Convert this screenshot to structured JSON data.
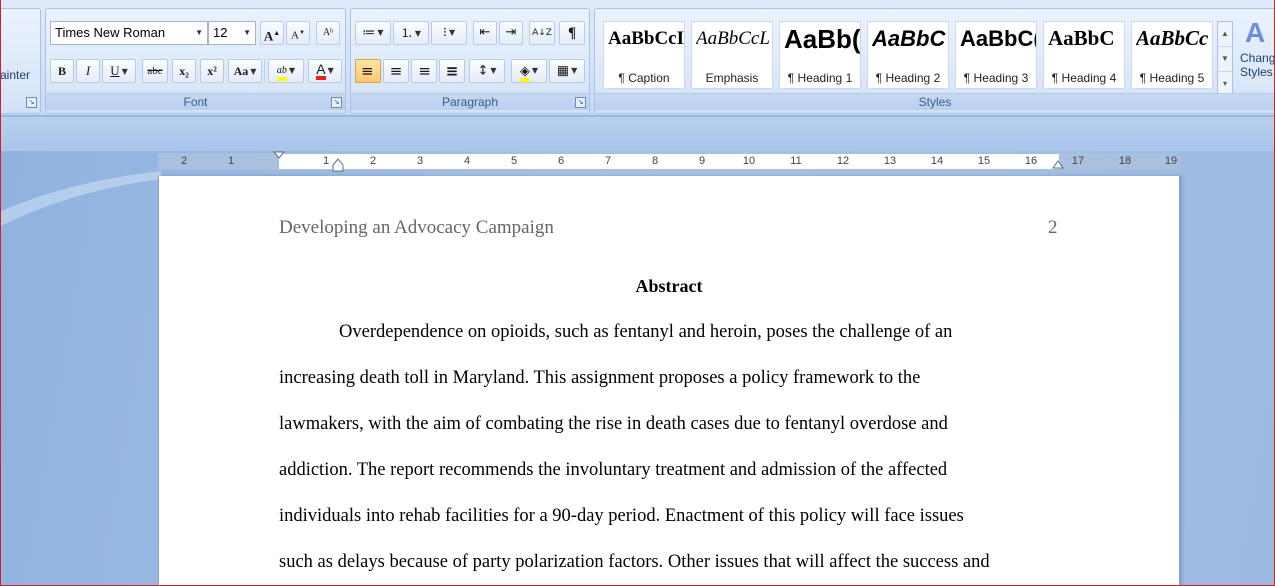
{
  "clipboard": {
    "format_painter_label": "ainter"
  },
  "font": {
    "group_label": "Font",
    "font_name": "Times New Roman",
    "font_size": "12",
    "grow_label": "A",
    "shrink_label": "A",
    "clear_label": "Aᵇ",
    "bold": "B",
    "italic": "I",
    "underline": "U",
    "strikethrough": "abc",
    "subscript": "x₂",
    "superscript": "x²",
    "change_case": "Aa",
    "highlight": "ab",
    "font_color_glyph": "A",
    "highlight_color": "#ffff00",
    "font_color": "#e0211d"
  },
  "paragraph": {
    "group_label": "Paragraph",
    "bullets": "≔",
    "numbering": "⒈",
    "multilevel": "⁝",
    "decrease_indent": "⇤",
    "increase_indent": "⇥",
    "sort": "A↓Z",
    "show_marks": "¶",
    "align_left": "≡",
    "center": "≡",
    "align_right": "≡",
    "justify": "≡",
    "line_spacing": "↕",
    "shading": "◈",
    "borders": "▦"
  },
  "styles": {
    "group_label": "Styles",
    "items": [
      {
        "sample": "AaBbCcI",
        "name": "¶ Caption"
      },
      {
        "sample": "AaBbCcL",
        "name": "Emphasis"
      },
      {
        "sample": "AaBb(",
        "name": "¶ Heading 1"
      },
      {
        "sample": "AaBbC",
        "name": "¶ Heading 2"
      },
      {
        "sample": "AaBbC(",
        "name": "¶ Heading 3"
      },
      {
        "sample": "AaBbC",
        "name": "¶ Heading 4"
      },
      {
        "sample": "AaBbCc",
        "name": "¶ Heading 5"
      }
    ],
    "change_styles_line1": "Chang",
    "change_styles_line2": "Styles"
  },
  "ruler": {
    "left_numbers": [
      "2",
      "1"
    ],
    "right_numbers": [
      "1",
      "2",
      "3",
      "4",
      "5",
      "6",
      "7",
      "8",
      "9",
      "10",
      "11",
      "12",
      "13",
      "14",
      "15",
      "16",
      "17",
      "18",
      "19"
    ]
  },
  "document": {
    "header_title": "Developing an Advocacy Campaign",
    "header_page": "2",
    "abstract_title": "Abstract",
    "lines": [
      "Overdependence on opioids, such as fentanyl and heroin, poses the challenge of an",
      "increasing death toll in Maryland. This assignment proposes a policy framework to the",
      "lawmakers, with the aim of combating the rise in death cases due to fentanyl overdose and",
      "addiction. The report recommends the involuntary treatment and admission of the affected",
      "individuals into rehab facilities for a 90-day period. Enactment of this policy will face issues",
      "such as delays because of party polarization factors. Other issues that will affect the success and"
    ]
  }
}
